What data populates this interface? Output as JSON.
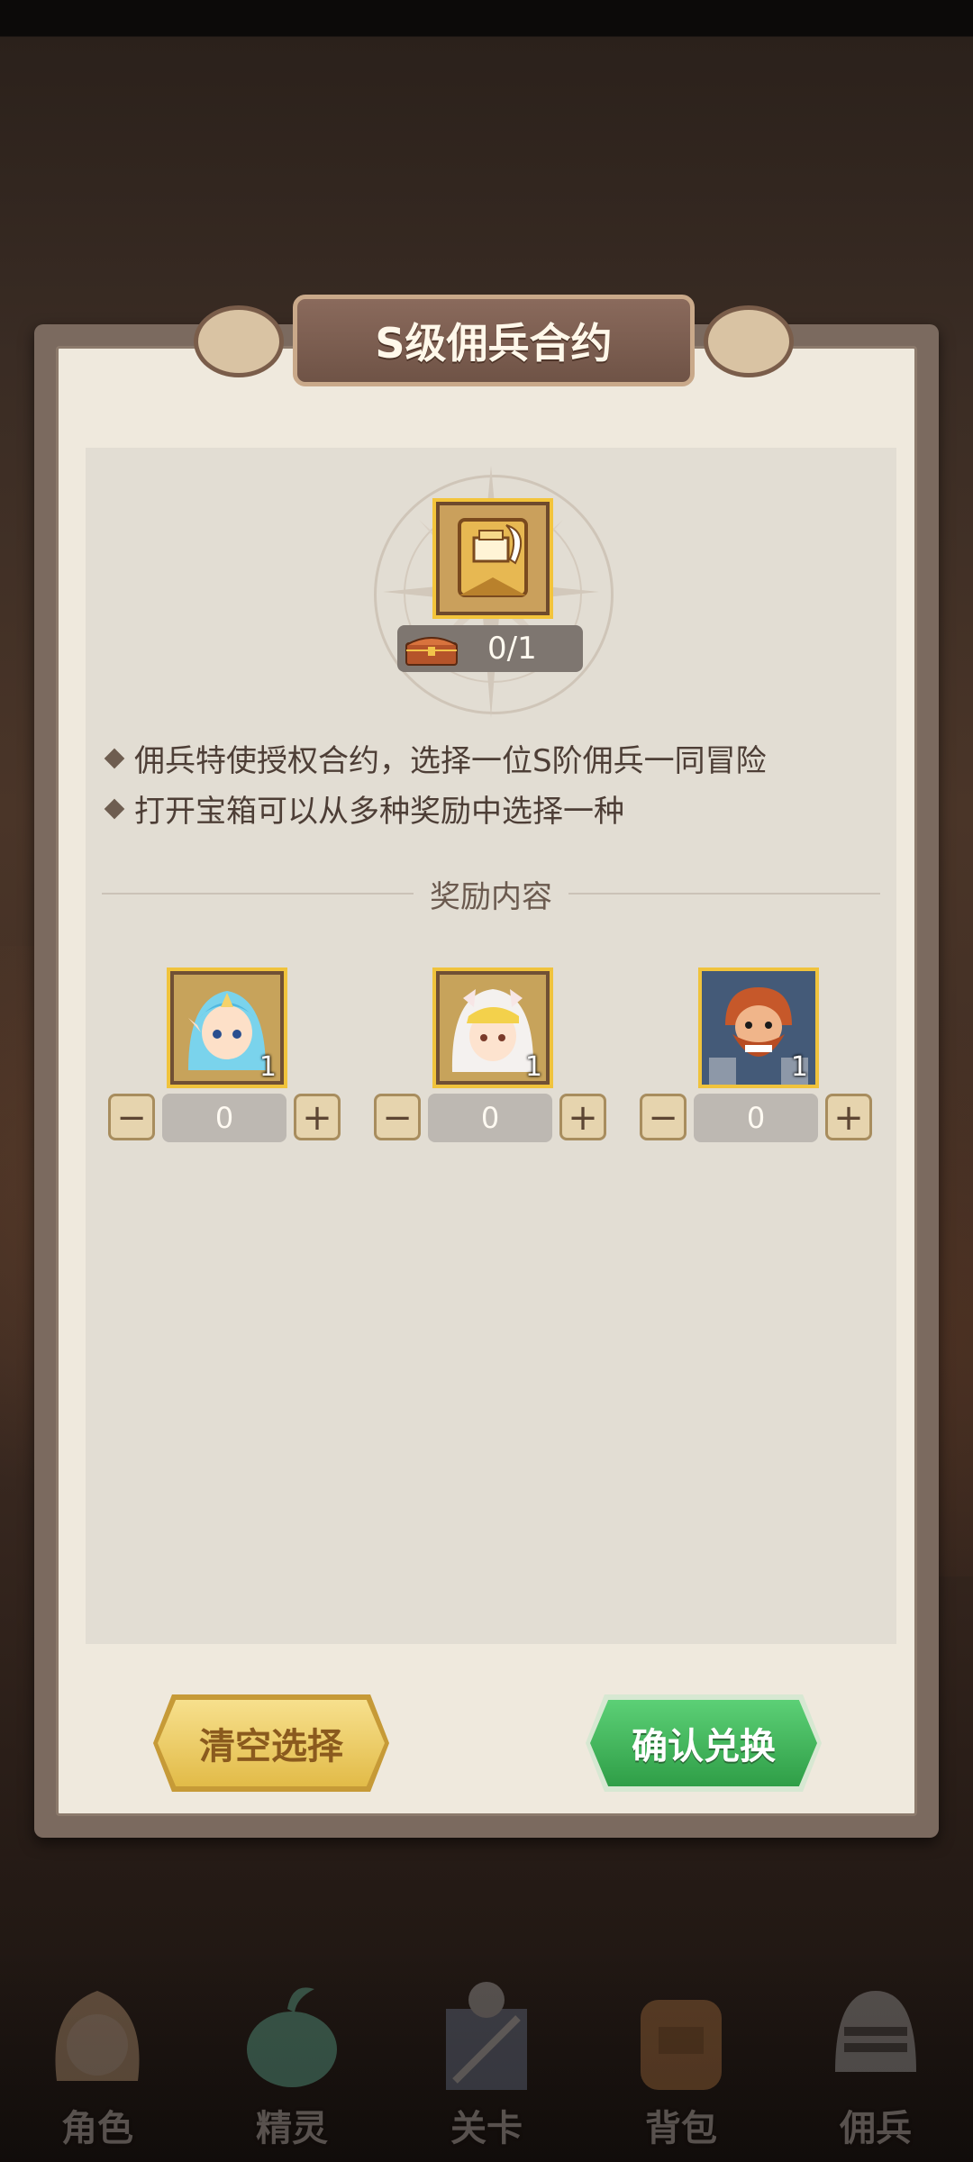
{
  "dialog": {
    "title": "S级佣兵合约",
    "item_count": "0/1",
    "desc_lines": [
      "佣兵特使授权合约，选择一位S阶佣兵一同冒险",
      "打开宝箱可以从多种奖励中选择一种"
    ],
    "section_title": "奖励内容",
    "rewards": [
      {
        "icon": "elf-girl-portrait",
        "count": "1",
        "qty": "0"
      },
      {
        "icon": "white-hair-girl-portrait",
        "count": "1",
        "qty": "0"
      },
      {
        "icon": "bearded-warrior-portrait",
        "count": "1",
        "qty": "0"
      }
    ],
    "clear_label": "清空选择",
    "confirm_label": "确认兑换"
  },
  "bottom_nav": [
    {
      "label": "角色",
      "icon": "character-icon"
    },
    {
      "label": "精灵",
      "icon": "spirit-icon"
    },
    {
      "label": "关卡",
      "icon": "stage-icon"
    },
    {
      "label": "背包",
      "icon": "backpack-icon"
    },
    {
      "label": "佣兵",
      "icon": "mercenary-icon"
    }
  ],
  "colors": {
    "clear_button": "#e2bb48",
    "confirm_button": "#2f9e47",
    "frame_gold": "#f0c33c"
  }
}
